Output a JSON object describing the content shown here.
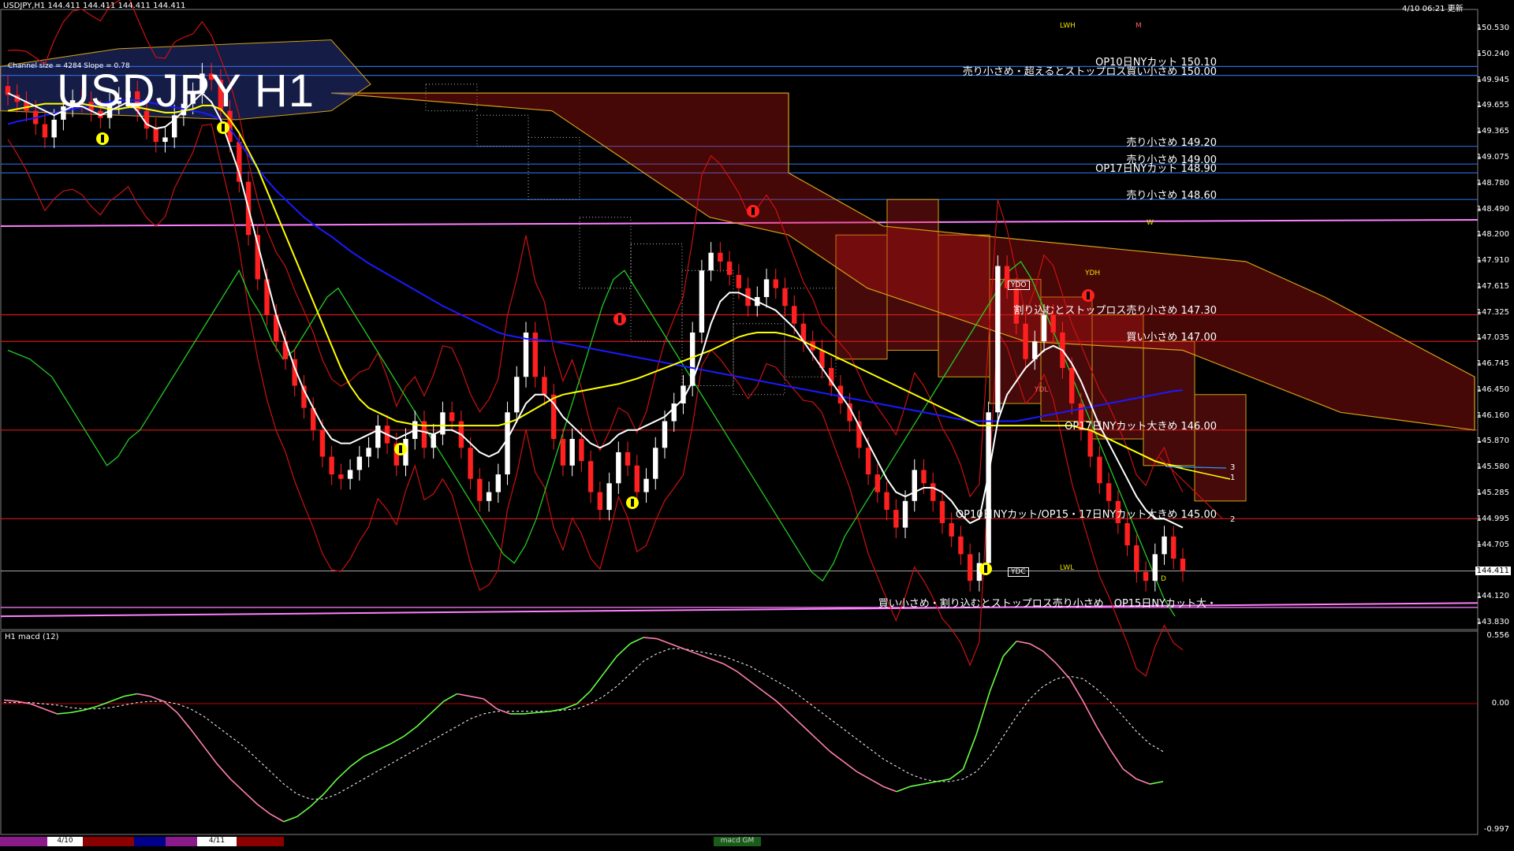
{
  "header": {
    "symbol_line": "USDJPY,H1  144.411 144.411 144.411 144.411",
    "datetime": "4/10 06:21 更新",
    "channel": "Channel size = 4284 Slope = 0.78",
    "big_title": "USDJPY H1",
    "sub_window_label": "H1  macd (12)"
  },
  "price_axis": {
    "ticks": [
      "150.530",
      "150.240",
      "149.945",
      "149.655",
      "149.365",
      "149.075",
      "148.780",
      "148.490",
      "148.200",
      "147.910",
      "147.615",
      "147.325",
      "147.035",
      "146.745",
      "146.450",
      "146.160",
      "145.870",
      "145.580",
      "145.285",
      "144.995",
      "144.705",
      "144.411",
      "144.120",
      "143.830"
    ],
    "current": "144.411"
  },
  "macd_axis": {
    "ticks": [
      "0.556",
      "0.00",
      "-0.997"
    ]
  },
  "level_labels": [
    {
      "text": "OP10日NYカット 150.10",
      "price": 150.1
    },
    {
      "text": "売り小さめ・超えるとストップロス買い小さめ 150.00",
      "price": 150.0
    },
    {
      "text": "売り小さめ 149.20",
      "price": 149.2
    },
    {
      "text": "売り小さめ 149.00",
      "price": 149.0
    },
    {
      "text": "OP17日NYカット 148.90",
      "price": 148.9
    },
    {
      "text": "売り小さめ 148.60",
      "price": 148.6
    },
    {
      "text": "割り込むとストップロス売り小さめ 147.30",
      "price": 147.3
    },
    {
      "text": "買い小さめ 147.00",
      "price": 147.0
    },
    {
      "text": "OP17日NYカット大きめ 146.00",
      "price": 146.0
    },
    {
      "text": "OP10日NYカット/OP15・17日NYカット大きめ 145.00",
      "price": 145.0
    },
    {
      "text": "買い小さめ・割り込むとストップロス売り小さめ　OP15日NYカット大・",
      "price": 144.0
    }
  ],
  "tags": {
    "ydo": "YDO",
    "ydc": "YDC",
    "ydh": "YDH",
    "ydl": "YDL",
    "lwh": "LWH",
    "lwl": "LWL",
    "m": "M",
    "w": "W",
    "d": "D",
    "n1": "1",
    "n2": "2",
    "n3": "3"
  },
  "tab_labels": {
    "d1": "4/10",
    "d2": "4/11",
    "macd_tab": "macd GM"
  },
  "colors": {
    "bull": "#ffffff",
    "bear": "#ff2020",
    "ma_white": "#ffffff",
    "ma_yellow": "#ffff00",
    "ma_blue": "#1a1aff",
    "chikou": "#22cc22",
    "kumo": "#ff2a2a",
    "bb": "#cc1111",
    "macd_up": "#66ff44",
    "macd_down": "#ff80b0",
    "signal": "#ffffff"
  },
  "chart_data": {
    "type": "candlestick",
    "title": "USDJPY H1",
    "close_series": [
      149.78,
      149.7,
      149.6,
      149.45,
      149.3,
      149.5,
      149.65,
      149.72,
      149.7,
      149.6,
      149.52,
      149.68,
      149.75,
      149.82,
      149.6,
      149.4,
      149.25,
      149.3,
      149.55,
      149.68,
      149.8,
      150.02,
      149.95,
      149.6,
      149.25,
      148.8,
      148.2,
      147.7,
      147.3,
      147.0,
      146.8,
      146.5,
      146.25,
      146.0,
      145.7,
      145.5,
      145.45,
      145.55,
      145.7,
      145.8,
      146.05,
      145.85,
      145.6,
      145.9,
      146.1,
      145.8,
      145.95,
      146.2,
      146.1,
      145.8,
      145.45,
      145.2,
      145.3,
      145.5,
      146.2,
      146.6,
      147.1,
      146.6,
      146.4,
      145.9,
      145.6,
      145.9,
      145.65,
      145.3,
      145.1,
      145.4,
      145.75,
      145.6,
      145.3,
      145.45,
      145.8,
      146.1,
      146.3,
      146.5,
      147.1,
      147.8,
      148.0,
      147.9,
      147.75,
      147.6,
      147.4,
      147.5,
      147.7,
      147.6,
      147.4,
      147.2,
      147.0,
      146.9,
      146.7,
      146.5,
      146.3,
      146.1,
      145.8,
      145.5,
      145.3,
      145.1,
      144.9,
      145.2,
      145.55,
      145.4,
      145.2,
      144.95,
      144.8,
      144.6,
      144.3,
      144.5,
      146.2,
      147.85,
      147.6,
      147.2,
      146.8,
      147.0,
      147.3,
      147.1,
      146.7,
      146.3,
      146.0,
      145.7,
      145.4,
      145.2,
      144.95,
      144.7,
      144.4,
      144.3,
      144.6,
      144.8,
      144.55,
      144.41
    ],
    "tenkan_white": [
      149.8,
      149.75,
      149.7,
      149.65,
      149.6,
      149.55,
      149.6,
      149.65,
      149.65,
      149.6,
      149.55,
      149.6,
      149.65,
      149.7,
      149.6,
      149.45,
      149.4,
      149.42,
      149.5,
      149.6,
      149.7,
      149.8,
      149.7,
      149.5,
      149.2,
      148.9,
      148.5,
      148.1,
      147.7,
      147.3,
      147.0,
      146.7,
      146.45,
      146.25,
      146.05,
      145.9,
      145.85,
      145.85,
      145.9,
      145.95,
      146.0,
      145.95,
      145.9,
      145.95,
      146.0,
      145.98,
      145.95,
      146.0,
      146.0,
      145.95,
      145.85,
      145.75,
      145.7,
      145.75,
      145.9,
      146.1,
      146.3,
      146.4,
      146.4,
      146.3,
      146.15,
      146.05,
      145.95,
      145.85,
      145.8,
      145.85,
      145.95,
      146.0,
      146.0,
      146.05,
      146.1,
      146.15,
      146.25,
      146.35,
      146.55,
      146.85,
      147.2,
      147.45,
      147.55,
      147.55,
      147.5,
      147.45,
      147.4,
      147.35,
      147.25,
      147.15,
      147.0,
      146.85,
      146.7,
      146.55,
      146.4,
      146.25,
      146.05,
      145.85,
      145.65,
      145.45,
      145.3,
      145.25,
      145.3,
      145.35,
      145.35,
      145.3,
      145.2,
      145.05,
      144.95,
      145.0,
      145.5,
      146.1,
      146.4,
      146.55,
      146.7,
      146.8,
      146.9,
      146.95,
      146.9,
      146.75,
      146.55,
      146.3,
      146.05,
      145.85,
      145.65,
      145.45,
      145.25,
      145.1,
      145.0,
      145.0,
      144.95,
      144.9
    ],
    "kijun_yellow": [
      149.6,
      149.62,
      149.64,
      149.66,
      149.68,
      149.68,
      149.68,
      149.68,
      149.68,
      149.66,
      149.64,
      149.62,
      149.62,
      149.64,
      149.64,
      149.62,
      149.6,
      149.58,
      149.58,
      149.6,
      149.62,
      149.66,
      149.66,
      149.62,
      149.5,
      149.35,
      149.15,
      148.95,
      148.7,
      148.45,
      148.2,
      147.95,
      147.7,
      147.45,
      147.2,
      146.95,
      146.7,
      146.5,
      146.35,
      146.25,
      146.2,
      146.15,
      146.1,
      146.08,
      146.06,
      146.05,
      146.05,
      146.05,
      146.05,
      146.05,
      146.05,
      146.05,
      146.05,
      146.05,
      146.08,
      146.12,
      146.18,
      146.24,
      146.3,
      146.36,
      146.4,
      146.42,
      146.44,
      146.46,
      146.48,
      146.5,
      146.52,
      146.55,
      146.58,
      146.62,
      146.66,
      146.7,
      146.74,
      146.78,
      146.82,
      146.86,
      146.9,
      146.95,
      147.0,
      147.05,
      147.08,
      147.1,
      147.1,
      147.1,
      147.08,
      147.05,
      147.0,
      146.95,
      146.9,
      146.85,
      146.8,
      146.75,
      146.7,
      146.65,
      146.6,
      146.55,
      146.5,
      146.45,
      146.4,
      146.35,
      146.3,
      146.25,
      146.2,
      146.15,
      146.1,
      146.05,
      146.05,
      146.05,
      146.05,
      146.05,
      146.05,
      146.05,
      146.05,
      146.05,
      146.05,
      146.05,
      146.02,
      146.0,
      145.95,
      145.9,
      145.85,
      145.8,
      145.75,
      145.7,
      145.65,
      145.62,
      145.6,
      145.58
    ],
    "ma_blue": [
      149.45,
      149.48,
      149.5,
      149.52,
      149.55,
      149.57,
      149.6,
      149.62,
      149.64,
      149.66,
      149.68,
      149.7,
      149.72,
      149.72,
      149.72,
      149.7,
      149.68,
      149.66,
      149.64,
      149.62,
      149.6,
      149.58,
      149.55,
      149.5,
      149.4,
      149.25,
      149.1,
      148.95,
      148.82,
      148.7,
      148.6,
      148.5,
      148.4,
      148.32,
      148.25,
      148.18,
      148.1,
      148.02,
      147.95,
      147.88,
      147.82,
      147.76,
      147.7,
      147.64,
      147.58,
      147.52,
      147.46,
      147.4,
      147.35,
      147.3,
      147.25,
      147.2,
      147.15,
      147.1,
      147.07,
      147.05,
      147.03,
      147.02,
      147.01,
      147.0,
      146.98,
      146.96,
      146.94,
      146.92,
      146.9,
      146.88,
      146.86,
      146.84,
      146.82,
      146.8,
      146.78,
      146.76,
      146.74,
      146.72,
      146.7,
      146.68,
      146.66,
      146.64,
      146.62,
      146.6,
      146.58,
      146.56,
      146.54,
      146.52,
      146.5,
      146.48,
      146.46,
      146.44,
      146.42,
      146.4,
      146.38,
      146.36,
      146.34,
      146.32,
      146.3,
      146.28,
      146.26,
      146.24,
      146.22,
      146.2,
      146.18,
      146.16,
      146.14,
      146.12,
      146.1,
      146.1,
      146.1,
      146.1,
      146.1,
      146.1,
      146.12,
      146.14,
      146.16,
      146.18,
      146.2,
      146.22,
      146.24,
      146.26,
      146.28,
      146.3,
      146.32,
      146.34,
      146.36,
      146.38,
      146.4,
      146.42,
      146.44,
      146.45
    ],
    "chikou_green": [
      146.9,
      146.85,
      146.8,
      146.7,
      146.6,
      146.4,
      146.2,
      146.0,
      145.8,
      145.6,
      145.7,
      145.9,
      146.0,
      146.2,
      146.4,
      146.6,
      146.8,
      147.0,
      147.2,
      147.4,
      147.6,
      147.8,
      147.5,
      147.3,
      147.0,
      146.8,
      146.9,
      147.1,
      147.3,
      147.5,
      147.6,
      147.4,
      147.2,
      147.0,
      146.8,
      146.6,
      146.4,
      146.2,
      146.0,
      145.8,
      145.6,
      145.4,
      145.2,
      145.0,
      144.8,
      144.6,
      144.5,
      144.7,
      145.0,
      145.4,
      145.8,
      146.2,
      146.6,
      147.0,
      147.4,
      147.7,
      147.8,
      147.6,
      147.4,
      147.2,
      147.0,
      146.8,
      146.6,
      146.4,
      146.2,
      146.0,
      145.8,
      145.6,
      145.4,
      145.2,
      145.0,
      144.8,
      144.6,
      144.4,
      144.3,
      144.5,
      144.8,
      145.0,
      145.2,
      145.4,
      145.6,
      145.8,
      146.0,
      146.2,
      146.4,
      146.6,
      146.8,
      147.0,
      147.2,
      147.4,
      147.6,
      147.8,
      147.9,
      147.7,
      147.4,
      147.1,
      146.8,
      146.5,
      146.2,
      145.9,
      145.6,
      145.3,
      145.0,
      144.7,
      144.4,
      144.1,
      143.9
    ],
    "kumo_band": [
      {
        "from": 149.6,
        "to": 149.9
      },
      {
        "from": 149.2,
        "to": 149.55
      },
      {
        "from": 148.6,
        "to": 149.3
      },
      {
        "from": 147.6,
        "to": 148.4
      },
      {
        "from": 147.0,
        "to": 148.1
      },
      {
        "from": 146.5,
        "to": 147.8
      },
      {
        "from": 146.4,
        "to": 147.2
      },
      {
        "from": 146.6,
        "to": 147.6
      },
      {
        "from": 146.8,
        "to": 148.2
      },
      {
        "from": 146.9,
        "to": 148.6
      },
      {
        "from": 146.6,
        "to": 148.2
      },
      {
        "from": 146.3,
        "to": 147.7
      },
      {
        "from": 146.1,
        "to": 147.5
      },
      {
        "from": 145.9,
        "to": 147.3
      },
      {
        "from": 145.6,
        "to": 147.0
      },
      {
        "from": 145.2,
        "to": 146.4
      }
    ],
    "macd": [
      0.05,
      0.04,
      0.02,
      -0.02,
      -0.06,
      -0.05,
      -0.03,
      0.0,
      0.04,
      0.08,
      0.1,
      0.08,
      0.04,
      -0.05,
      -0.18,
      -0.32,
      -0.46,
      -0.58,
      -0.68,
      -0.78,
      -0.86,
      -0.92,
      -0.88,
      -0.8,
      -0.7,
      -0.58,
      -0.48,
      -0.4,
      -0.35,
      -0.3,
      -0.24,
      -0.16,
      -0.06,
      0.04,
      0.1,
      0.08,
      0.06,
      -0.02,
      -0.06,
      -0.06,
      -0.05,
      -0.04,
      -0.02,
      0.02,
      0.12,
      0.26,
      0.4,
      0.5,
      0.55,
      0.54,
      0.5,
      0.46,
      0.42,
      0.38,
      0.34,
      0.28,
      0.2,
      0.12,
      0.04,
      -0.06,
      -0.16,
      -0.26,
      -0.36,
      -0.44,
      -0.52,
      -0.58,
      -0.64,
      -0.68,
      -0.64,
      -0.62,
      -0.6,
      -0.58,
      -0.5,
      -0.22,
      0.12,
      0.4,
      0.52,
      0.5,
      0.44,
      0.34,
      0.22,
      0.04,
      -0.16,
      -0.34,
      -0.5,
      -0.58,
      -0.62,
      -0.6
    ],
    "signal": [
      0.03,
      0.03,
      0.03,
      0.02,
      0.01,
      -0.01,
      -0.02,
      -0.02,
      -0.01,
      0.01,
      0.03,
      0.04,
      0.04,
      0.02,
      -0.02,
      -0.08,
      -0.16,
      -0.24,
      -0.32,
      -0.42,
      -0.52,
      -0.62,
      -0.7,
      -0.74,
      -0.74,
      -0.7,
      -0.64,
      -0.58,
      -0.52,
      -0.46,
      -0.4,
      -0.34,
      -0.28,
      -0.22,
      -0.16,
      -0.1,
      -0.06,
      -0.04,
      -0.04,
      -0.04,
      -0.04,
      -0.04,
      -0.03,
      -0.02,
      0.02,
      0.08,
      0.16,
      0.26,
      0.36,
      0.42,
      0.46,
      0.46,
      0.44,
      0.42,
      0.4,
      0.36,
      0.32,
      0.26,
      0.2,
      0.14,
      0.06,
      -0.02,
      -0.1,
      -0.18,
      -0.26,
      -0.34,
      -0.42,
      -0.48,
      -0.54,
      -0.58,
      -0.6,
      -0.6,
      -0.58,
      -0.52,
      -0.4,
      -0.24,
      -0.08,
      0.06,
      0.16,
      0.22,
      0.24,
      0.22,
      0.14,
      0.04,
      -0.08,
      -0.2,
      -0.3,
      -0.36
    ],
    "ylim": [
      143.83,
      150.53
    ],
    "macd_ylim": [
      -0.997,
      0.556
    ]
  }
}
